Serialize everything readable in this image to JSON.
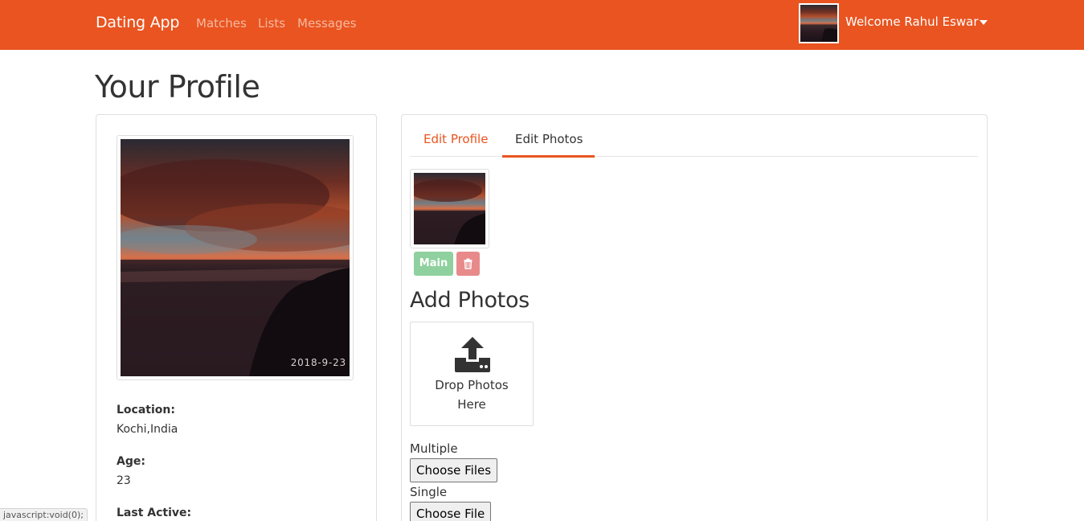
{
  "navbar": {
    "brand": "Dating App",
    "links": {
      "matches": "Matches",
      "lists": "Lists",
      "messages": "Messages"
    },
    "welcome": "Welcome Rahul Eswar",
    "color": "#e95420"
  },
  "page": {
    "title": "Your Profile"
  },
  "profile": {
    "photo_date": "2018-9-23",
    "location_label": "Location:",
    "location_value": "Kochi,India",
    "age_label": "Age:",
    "age_value": "23",
    "last_active_label": "Last Active:"
  },
  "tabs": {
    "edit_profile": "Edit Profile",
    "edit_photos": "Edit Photos",
    "active": "Edit Photos"
  },
  "photos": {
    "main_button": "Main",
    "delete_icon": "trash-icon"
  },
  "upload": {
    "title": "Add Photos",
    "drop_line1": "Drop Photos",
    "drop_line2": "Here",
    "multiple_label": "Multiple",
    "multiple_button": "Choose Files",
    "single_label": "Single",
    "single_button": "Choose File"
  },
  "status_bar": "javascript:void(0);"
}
